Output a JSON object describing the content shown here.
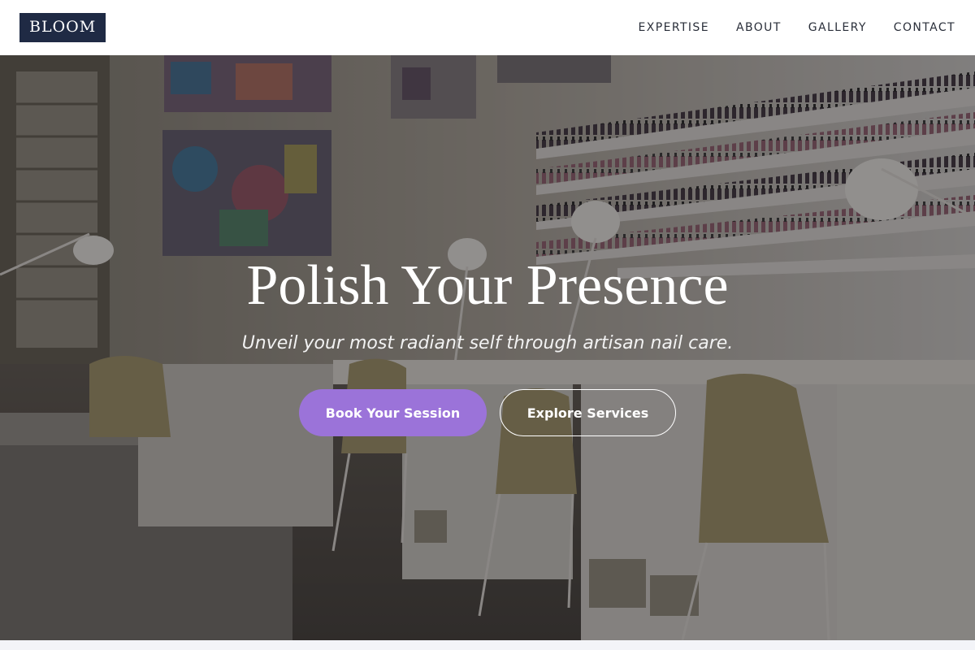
{
  "brand": {
    "logo_text": "BLOOM"
  },
  "nav": {
    "items": [
      {
        "label": "EXPERTISE"
      },
      {
        "label": "ABOUT"
      },
      {
        "label": "GALLERY"
      },
      {
        "label": "CONTACT"
      }
    ]
  },
  "hero": {
    "title": "Polish Your Presence",
    "subtitle": "Unveil your most radiant self through artisan nail care.",
    "primary_button": "Book Your Session",
    "secondary_button": "Explore Services",
    "background_image": "nail-salon-interior-photo"
  },
  "colors": {
    "logo_bg": "#1f2a44",
    "primary_button": "#9b73d9",
    "nav_text": "#2a2f3a"
  }
}
